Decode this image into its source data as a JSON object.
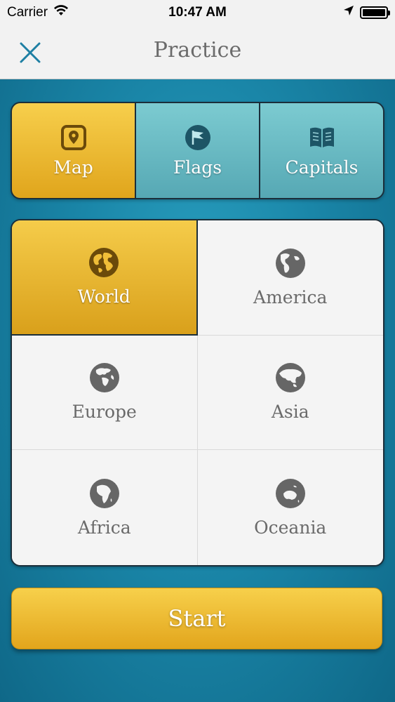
{
  "status_bar": {
    "carrier": "Carrier",
    "time": "10:47 AM"
  },
  "nav": {
    "title": "Practice"
  },
  "modes": [
    {
      "label": "Map",
      "icon": "map-pin-icon",
      "active": true
    },
    {
      "label": "Flags",
      "icon": "flag-icon",
      "active": false
    },
    {
      "label": "Capitals",
      "icon": "book-icon",
      "active": false
    }
  ],
  "regions": [
    {
      "label": "World",
      "icon": "globe-icon",
      "active": true
    },
    {
      "label": "America",
      "icon": "globe-icon",
      "active": false
    },
    {
      "label": "Europe",
      "icon": "globe-icon",
      "active": false
    },
    {
      "label": "Asia",
      "icon": "globe-icon",
      "active": false
    },
    {
      "label": "Africa",
      "icon": "globe-icon",
      "active": false
    },
    {
      "label": "Oceania",
      "icon": "globe-icon",
      "active": false
    }
  ],
  "start_label": "Start",
  "colors": {
    "accent_gold": "#e8b22a",
    "teal": "#5eb0bb",
    "background": "#1a86a8",
    "active_icon": "#6b4a0a",
    "inactive_icon": "#6a6a6a"
  }
}
